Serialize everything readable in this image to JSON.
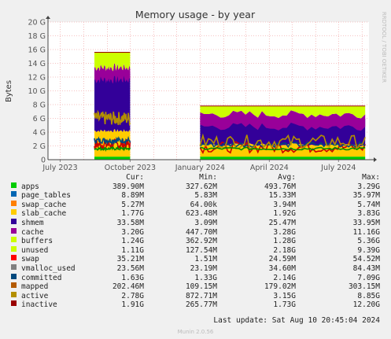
{
  "chart_data": {
    "type": "area",
    "title": "Memory usage - by year",
    "ylabel": "Bytes",
    "side_label": "RRDTOOL / TOBI OETIKER",
    "y_ticks": [
      "0",
      "2 G",
      "4 G",
      "6 G",
      "8 G",
      "10 G",
      "12 G",
      "14 G",
      "16 G",
      "18 G",
      "20 G"
    ],
    "ylim": [
      0,
      20
    ],
    "x_ticks": [
      "July 2023",
      "October 2023",
      "January 2024",
      "April 2024",
      "July 2024"
    ],
    "xlim": [
      "2023-06-15",
      "2024-08-10"
    ],
    "segments": [
      {
        "start": "2023-08-15",
        "end": "2023-10-01",
        "total": 15.6,
        "unused_base": 13.0,
        "cache_top": 12.8,
        "cache_base": 4.2,
        "slab_top": 4.2,
        "active_level": 6.0,
        "inactive_level": 2.2,
        "mapped_level": 2.8
      },
      {
        "start": "2024-01-01",
        "end": "2024-08-05",
        "total": 7.8,
        "unused_base": 6.4,
        "cache_top": 6.0,
        "cache_base": 2.2,
        "slab_top": 2.2,
        "active_level": 2.6,
        "inactive_level": 1.8,
        "mapped_level": 2.2
      }
    ],
    "columns": [
      "Cur:",
      "Min:",
      "Avg:",
      "Max:"
    ],
    "series": [
      {
        "name": "apps",
        "color": "#00cc00",
        "cur": "389.90M",
        "min": "327.62M",
        "avg": "493.76M",
        "max": "3.29G"
      },
      {
        "name": "page_tables",
        "color": "#0066b3",
        "cur": "8.89M",
        "min": "5.83M",
        "avg": "15.33M",
        "max": "35.97M"
      },
      {
        "name": "swap_cache",
        "color": "#ff8000",
        "cur": "5.27M",
        "min": "64.00k",
        "avg": "3.94M",
        "max": "5.74M"
      },
      {
        "name": "slab_cache",
        "color": "#ffcc00",
        "cur": "1.77G",
        "min": "623.48M",
        "avg": "1.92G",
        "max": "3.83G"
      },
      {
        "name": "shmem",
        "color": "#330099",
        "cur": "33.58M",
        "min": "3.09M",
        "avg": "25.47M",
        "max": "33.95M"
      },
      {
        "name": "cache",
        "color": "#990099",
        "cur": "3.20G",
        "min": "447.70M",
        "avg": "3.28G",
        "max": "11.16G"
      },
      {
        "name": "buffers",
        "color": "#ccff00",
        "cur": "1.24G",
        "min": "362.92M",
        "avg": "1.28G",
        "max": "5.36G"
      },
      {
        "name": "unused",
        "color": "#ccff00",
        "cur": "1.11G",
        "min": "127.54M",
        "avg": "2.18G",
        "max": "9.39G"
      },
      {
        "name": "swap",
        "color": "#ff0000",
        "cur": "35.21M",
        "min": "1.51M",
        "avg": "24.59M",
        "max": "54.52M"
      },
      {
        "name": "vmalloc_used",
        "color": "#808080",
        "cur": "23.56M",
        "min": "23.19M",
        "avg": "34.60M",
        "max": "84.43M"
      },
      {
        "name": "committed",
        "color": "#008f00",
        "cur": "1.63G",
        "min": "1.33G",
        "avg": "2.14G",
        "max": "7.09G"
      },
      {
        "name": "mapped",
        "color": "#00487d",
        "cur": "202.46M",
        "min": "109.15M",
        "avg": "179.02M",
        "max": "303.15M"
      },
      {
        "name": "active",
        "color": "#b35a00",
        "cur": "2.78G",
        "min": "872.71M",
        "avg": "3.15G",
        "max": "8.85G"
      },
      {
        "name": "inactive",
        "color": "#b38f00",
        "cur": "1.91G",
        "min": "265.77M",
        "avg": "1.73G",
        "max": "12.20G"
      }
    ],
    "legend_colors_shown": [
      "#00cc00",
      "#0066b3",
      "#ff8000",
      "#ffcc00",
      "#330099",
      "#990099",
      "#ccff00",
      "#ccff00",
      "#ff0000",
      "#808080",
      "#00487d",
      "#b35a00",
      "#b38f00",
      "#990000"
    ]
  },
  "footer": {
    "last_update": "Last update:  Sat Aug 10 20:45:04 2024",
    "munin": "Munin 2.0.56"
  }
}
